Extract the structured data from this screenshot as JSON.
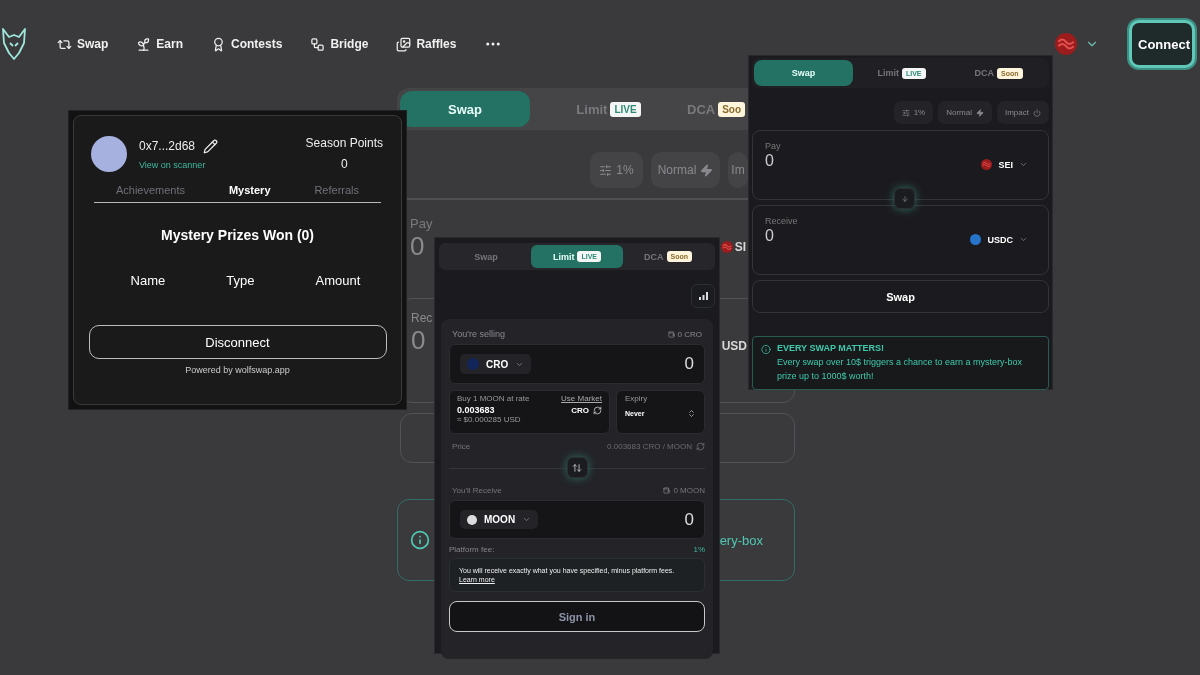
{
  "nav": {
    "items": [
      {
        "label": "Swap"
      },
      {
        "label": "Earn"
      },
      {
        "label": "Contests"
      },
      {
        "label": "Bridge"
      },
      {
        "label": "Raffles"
      }
    ],
    "connect": "Connect"
  },
  "background_panel": {
    "tabs": [
      {
        "label": "Swap",
        "selected": true
      },
      {
        "label": "Limit",
        "badge": {
          "text": "LIVE",
          "kind": "live"
        },
        "selected": false
      },
      {
        "label": "DCA",
        "badge": {
          "text": "Soo",
          "kind": "soon"
        },
        "selected": false
      }
    ],
    "chips": [
      "1%",
      "Normal",
      "Im"
    ],
    "pay": {
      "label": "Pay",
      "amount": "0",
      "token": "SI"
    },
    "receive": {
      "label": "Rec",
      "amount": "0",
      "token": "USD"
    },
    "info": {
      "text": "ery-box"
    }
  },
  "profile_panel": {
    "address": "0x7...2d68",
    "scanner_link": "View on scanner",
    "points_label": "Season Points",
    "points": "0",
    "tabs": [
      {
        "label": "Achievements",
        "selected": false
      },
      {
        "label": "Mystery",
        "selected": true
      },
      {
        "label": "Referrals",
        "selected": false
      }
    ],
    "heading": "Mystery Prizes Won (0)",
    "columns": [
      "Name",
      "Type",
      "Amount"
    ],
    "disconnect": "Disconnect",
    "footer": "Powered by wolfswap.app"
  },
  "limit_panel": {
    "tabs": [
      {
        "label": "Swap",
        "selected": false
      },
      {
        "label": "Limit",
        "badge": {
          "text": "LIVE",
          "kind": "live"
        },
        "selected": true
      },
      {
        "label": "DCA",
        "badge": {
          "text": "Soon",
          "kind": "soon"
        },
        "selected": false
      }
    ],
    "selling": {
      "label": "You're selling",
      "balance": "0 CRO",
      "token": "CRO",
      "amount": "0"
    },
    "rate": {
      "label": "Buy 1 MOON at rate",
      "link": "Use Market",
      "value": "0.003683",
      "unit": "CRO",
      "usd": "≈ $0.000285 USD"
    },
    "expiry": {
      "label": "Expiry",
      "value": "Never"
    },
    "price": {
      "label": "Price",
      "value": "0.003683 CRO / MOON"
    },
    "receive": {
      "label": "You'll Receive",
      "balance": "0 MOON",
      "token": "MOON",
      "amount": "0"
    },
    "fee": {
      "label": "Platform fee:",
      "value": "1%"
    },
    "notice": {
      "text": "You will receive exactly what you have specified, minus platform fees.",
      "link": "Learn more"
    },
    "button": "Sign in"
  },
  "swap_panel": {
    "tabs": [
      {
        "label": "Swap",
        "selected": true
      },
      {
        "label": "Limit",
        "badge": {
          "text": "LIVE",
          "kind": "live"
        },
        "selected": false
      },
      {
        "label": "DCA",
        "badge": {
          "text": "Soon",
          "kind": "soon"
        },
        "selected": false
      }
    ],
    "chips": [
      "1%",
      "Normal",
      "Impact"
    ],
    "pay": {
      "label": "Pay",
      "amount": "0",
      "token": "SEI"
    },
    "receive": {
      "label": "Receive",
      "amount": "0",
      "token": "USDC"
    },
    "button": "Swap",
    "info": {
      "title": "EVERY SWAP MATTERS!",
      "text": "Every swap over 10$ triggers a chance to earn a mystery-box prize up to 1000$ worth!"
    }
  }
}
